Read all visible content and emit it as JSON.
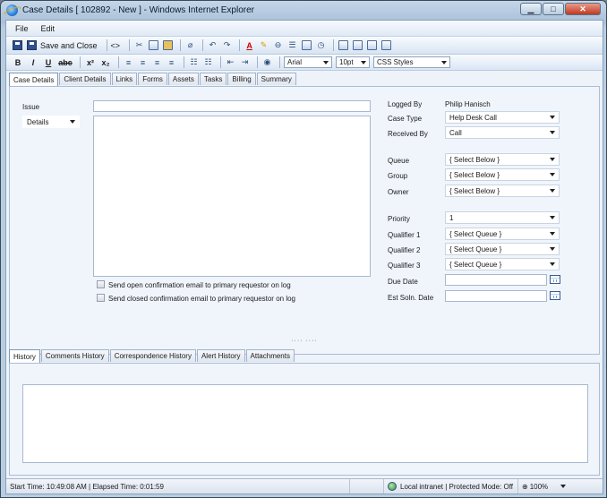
{
  "window": {
    "title": "Case Details [ 102892 - New ] - Windows Internet Explorer"
  },
  "menu": [
    "File",
    "Edit"
  ],
  "toolbar": {
    "save_close": "Save and Close",
    "source_toggle": "<>"
  },
  "format": {
    "bold": "B",
    "italic": "I",
    "underline": "U",
    "strike": "abc",
    "superscript": "x²",
    "subscript": "x₂",
    "font": "Arial",
    "size": "10pt",
    "styles": "CSS Styles"
  },
  "tabs_top": [
    "Case Details",
    "Client Details",
    "Links",
    "Forms",
    "Assets",
    "Tasks",
    "Billing",
    "Summary"
  ],
  "form": {
    "issue_label": "Issue",
    "details_select": "Details",
    "confirm_open": "Send open confirmation email to primary requestor on log",
    "confirm_closed": "Send closed confirmation email to primary requestor on log",
    "logged_by_label": "Logged By",
    "logged_by_value": "Philip Hanisch",
    "case_type_label": "Case Type",
    "case_type_value": "Help Desk Call",
    "received_by_label": "Received By",
    "received_by_value": "Call",
    "queue_label": "Queue",
    "queue_value": "{ Select Below }",
    "group_label": "Group",
    "group_value": "{ Select Below }",
    "owner_label": "Owner",
    "owner_value": "{ Select Below }",
    "priority_label": "Priority",
    "priority_value": "1",
    "q1_label": "Qualifier 1",
    "q1_value": "{ Select Queue }",
    "q2_label": "Qualifier 2",
    "q2_value": "{ Select Queue }",
    "q3_label": "Qualifier 3",
    "q3_value": "{ Select Queue }",
    "due_label": "Due Date",
    "est_label": "Est Soln. Date"
  },
  "splitter": "····  ····",
  "tabs_bottom": [
    "History",
    "Comments History",
    "Correspondence History",
    "Alert History",
    "Attachments"
  ],
  "status": {
    "time": "Start Time: 10:49:08 AM | Elapsed Time: 0:01:59",
    "zone": "Local intranet | Protected Mode: Off",
    "zoom": "100%"
  }
}
